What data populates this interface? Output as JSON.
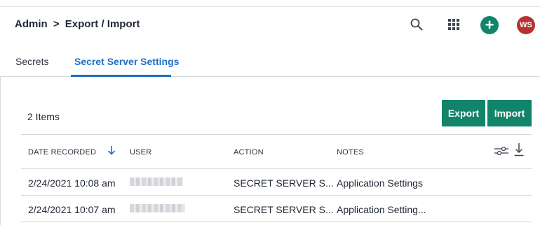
{
  "header": {
    "breadcrumb": {
      "root": "Admin",
      "separator": ">",
      "current": "Export / Import"
    },
    "icons": [
      "search-icon",
      "apps-grid-icon",
      "add-icon"
    ],
    "add_label": "+",
    "avatar_initials": "WS",
    "colors": {
      "accent": "#12846a",
      "avatar": "#b83131",
      "tab_active": "#1d6fc5"
    }
  },
  "tabs": [
    {
      "label": "Secrets",
      "active": false
    },
    {
      "label": "Secret Server Settings",
      "active": true
    }
  ],
  "toolbar": {
    "items_count": "2 Items",
    "export_label": "Export",
    "import_label": "Import"
  },
  "table": {
    "columns": [
      "DATE RECORDED",
      "USER",
      "ACTION",
      "NOTES"
    ],
    "sort": {
      "column": "DATE RECORDED",
      "direction": "descending"
    },
    "rows": [
      {
        "date": "2/24/2021 10:08 am",
        "user": "",
        "action": "SECRET SERVER S...",
        "notes": "Application Settings"
      },
      {
        "date": "2/24/2021 10:07 am",
        "user": "",
        "action": "SECRET SERVER S...",
        "notes": "Application Setting..."
      }
    ]
  }
}
